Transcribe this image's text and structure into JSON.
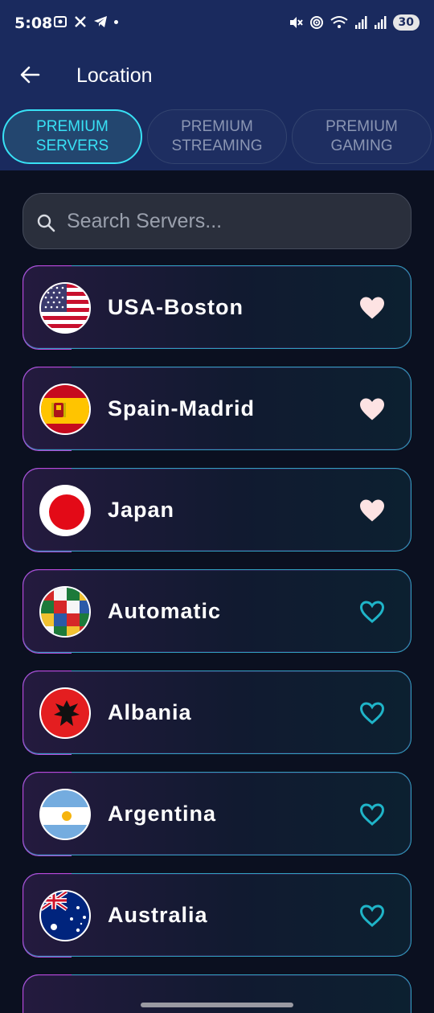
{
  "status_bar": {
    "time": "5:08",
    "battery": "30",
    "left_icons": [
      "screenshot-icon",
      "x-icon",
      "telegram-icon",
      "dot-icon"
    ],
    "right_icons": [
      "mute-icon",
      "hotspot-icon",
      "wifi-icon",
      "signal-icon",
      "signal-icon"
    ]
  },
  "header": {
    "title": "Location",
    "back_icon": "arrow-left-icon"
  },
  "tabs": [
    {
      "line1": "PREMIUM",
      "line2": "SERVERS",
      "active": true
    },
    {
      "line1": "PREMIUM",
      "line2": "STREAMING",
      "active": false
    },
    {
      "line1": "PREMIUM",
      "line2": "GAMING",
      "active": false
    }
  ],
  "search": {
    "placeholder": "Search Servers...",
    "value": ""
  },
  "servers": [
    {
      "name": "USA-Boston",
      "flag": "usa-flag",
      "favorite": true
    },
    {
      "name": "Spain-Madrid",
      "flag": "spain-flag",
      "favorite": true
    },
    {
      "name": "Japan",
      "flag": "japan-flag",
      "favorite": true
    },
    {
      "name": "Automatic",
      "flag": "world-flags-icon",
      "favorite": false
    },
    {
      "name": "Albania",
      "flag": "albania-flag",
      "favorite": false
    },
    {
      "name": "Argentina",
      "flag": "argentina-flag",
      "favorite": false
    },
    {
      "name": "Australia",
      "flag": "australia-flag",
      "favorite": false
    }
  ],
  "colors": {
    "header_bg": "#1a2a5e",
    "accent": "#38e1f5",
    "favorite_filled": "#fde3e3",
    "favorite_outline": "#1fb4c8"
  }
}
